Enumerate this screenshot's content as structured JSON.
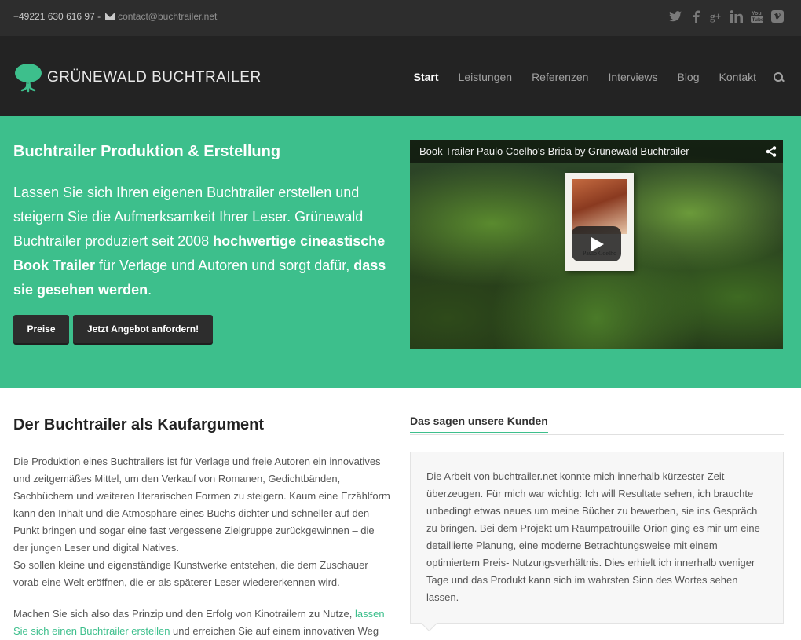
{
  "topbar": {
    "phone": "+49221 630 616 97 -",
    "email": "contact@buchtrailer.net",
    "social": [
      "twitter-icon",
      "facebook-icon",
      "google-plus-icon",
      "linkedin-icon",
      "youtube-icon",
      "vimeo-icon"
    ]
  },
  "header": {
    "brand": "GRÜNEWALD BUCHTRAILER",
    "nav": [
      "Start",
      "Leistungen",
      "Referenzen",
      "Interviews",
      "Blog",
      "Kontakt"
    ]
  },
  "hero": {
    "title": "Buchtrailer Produktion & Erstellung",
    "lead_part1": "Lassen Sie sich Ihren eigenen Buchtrailer erstellen und steigern Sie die Aufmerksamkeit Ihrer Leser. Grünewald Buchtrailer produziert seit 2008 ",
    "lead_bold1": "hochwertige cineastische Book Trailer",
    "lead_part2": " für Verlage und Autoren und sorgt dafür, ",
    "lead_bold2": "dass sie gesehen werden",
    "lead_part3": ".",
    "btn_preise": "Preise",
    "btn_angebot": "Jetzt Angebot anfordern!",
    "video_title": "Book Trailer Paulo Coelho's Brida by Grünewald Buchtrailer",
    "book_author": "Paulo Coelho"
  },
  "content": {
    "heading": "Der Buchtrailer als Kaufargument",
    "paragraph1": "Die Produktion eines Buchtrailers ist für Verlage und freie Autoren ein innovatives und zeitgemäßes Mittel, um den Verkauf von Romanen, Gedichtbänden, Sachbüchern und weiteren literarischen Formen zu steigern. Kaum eine Erzählform kann den Inhalt und die Atmosphäre eines Buchs dichter und schneller auf den Punkt bringen und sogar eine fast vergessene Zielgruppe zurückgewinnen  – die der jungen Leser und digital Natives.",
    "paragraph1b": "So sollen kleine und eigenständige Kunstwerke entstehen, die dem Zuschauer vorab eine Welt eröffnen, die er als späterer Leser wiedererkennen wird.",
    "paragraph2_start": "Machen Sie sich also das Prinzip und den Erfolg von Kinotrailern zu Nutze, ",
    "paragraph2_link": "lassen Sie sich einen Buchtrailer erstellen",
    "paragraph2_end": " und erreichen Sie auf einem innovativen Weg"
  },
  "testimonials": {
    "tab_title": "Das sagen unsere Kunden",
    "quote": "Die Arbeit von buchtrailer.net konnte mich innerhalb kürzester Zeit überzeugen. Für mich war wichtig: Ich will Resultate sehen, ich brauchte unbedingt etwas neues um meine Bücher zu bewerben, sie ins Gespräch zu bringen. Bei dem Projekt um Raumpatrouille Orion ging es mir um eine detaillierte Planung, eine moderne Betrachtungsweise mit einem optimiertem Preis- Nutzungsverhältnis. Dies erhielt ich innerhalb weniger Tage und das Produkt kann sich im wahrsten Sinn des Wortes sehen lassen."
  },
  "colors": {
    "accent": "#3dbf8c",
    "topbar": "#2d2d2d",
    "header": "#232323"
  }
}
